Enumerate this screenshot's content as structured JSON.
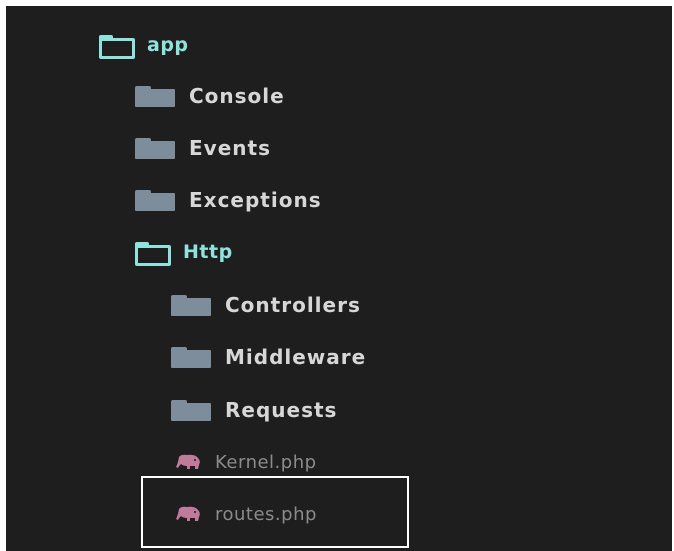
{
  "tree": {
    "app": {
      "label": "app",
      "icon": "folder-open-icon"
    },
    "console": {
      "label": "Console",
      "icon": "folder-icon"
    },
    "events": {
      "label": "Events",
      "icon": "folder-icon"
    },
    "exceptions": {
      "label": "Exceptions",
      "icon": "folder-icon"
    },
    "http": {
      "label": "Http",
      "icon": "folder-open-icon"
    },
    "controllers": {
      "label": "Controllers",
      "icon": "folder-icon"
    },
    "middleware": {
      "label": "Middleware",
      "icon": "folder-icon"
    },
    "requests": {
      "label": "Requests",
      "icon": "folder-icon"
    },
    "kernel": {
      "label": "Kernel.php",
      "icon": "php-elephant-icon"
    },
    "routes": {
      "label": "routes.php",
      "icon": "php-elephant-icon",
      "highlighted": true
    }
  },
  "colors": {
    "background": "#1e1e1e",
    "open_folder": "#8fe3dc",
    "closed_folder": "#7e8d9b",
    "folder_text": "#d7d7d7",
    "file_text": "#8b8b8b",
    "php_icon": "#c07b9a",
    "highlight": "#ffffff"
  }
}
